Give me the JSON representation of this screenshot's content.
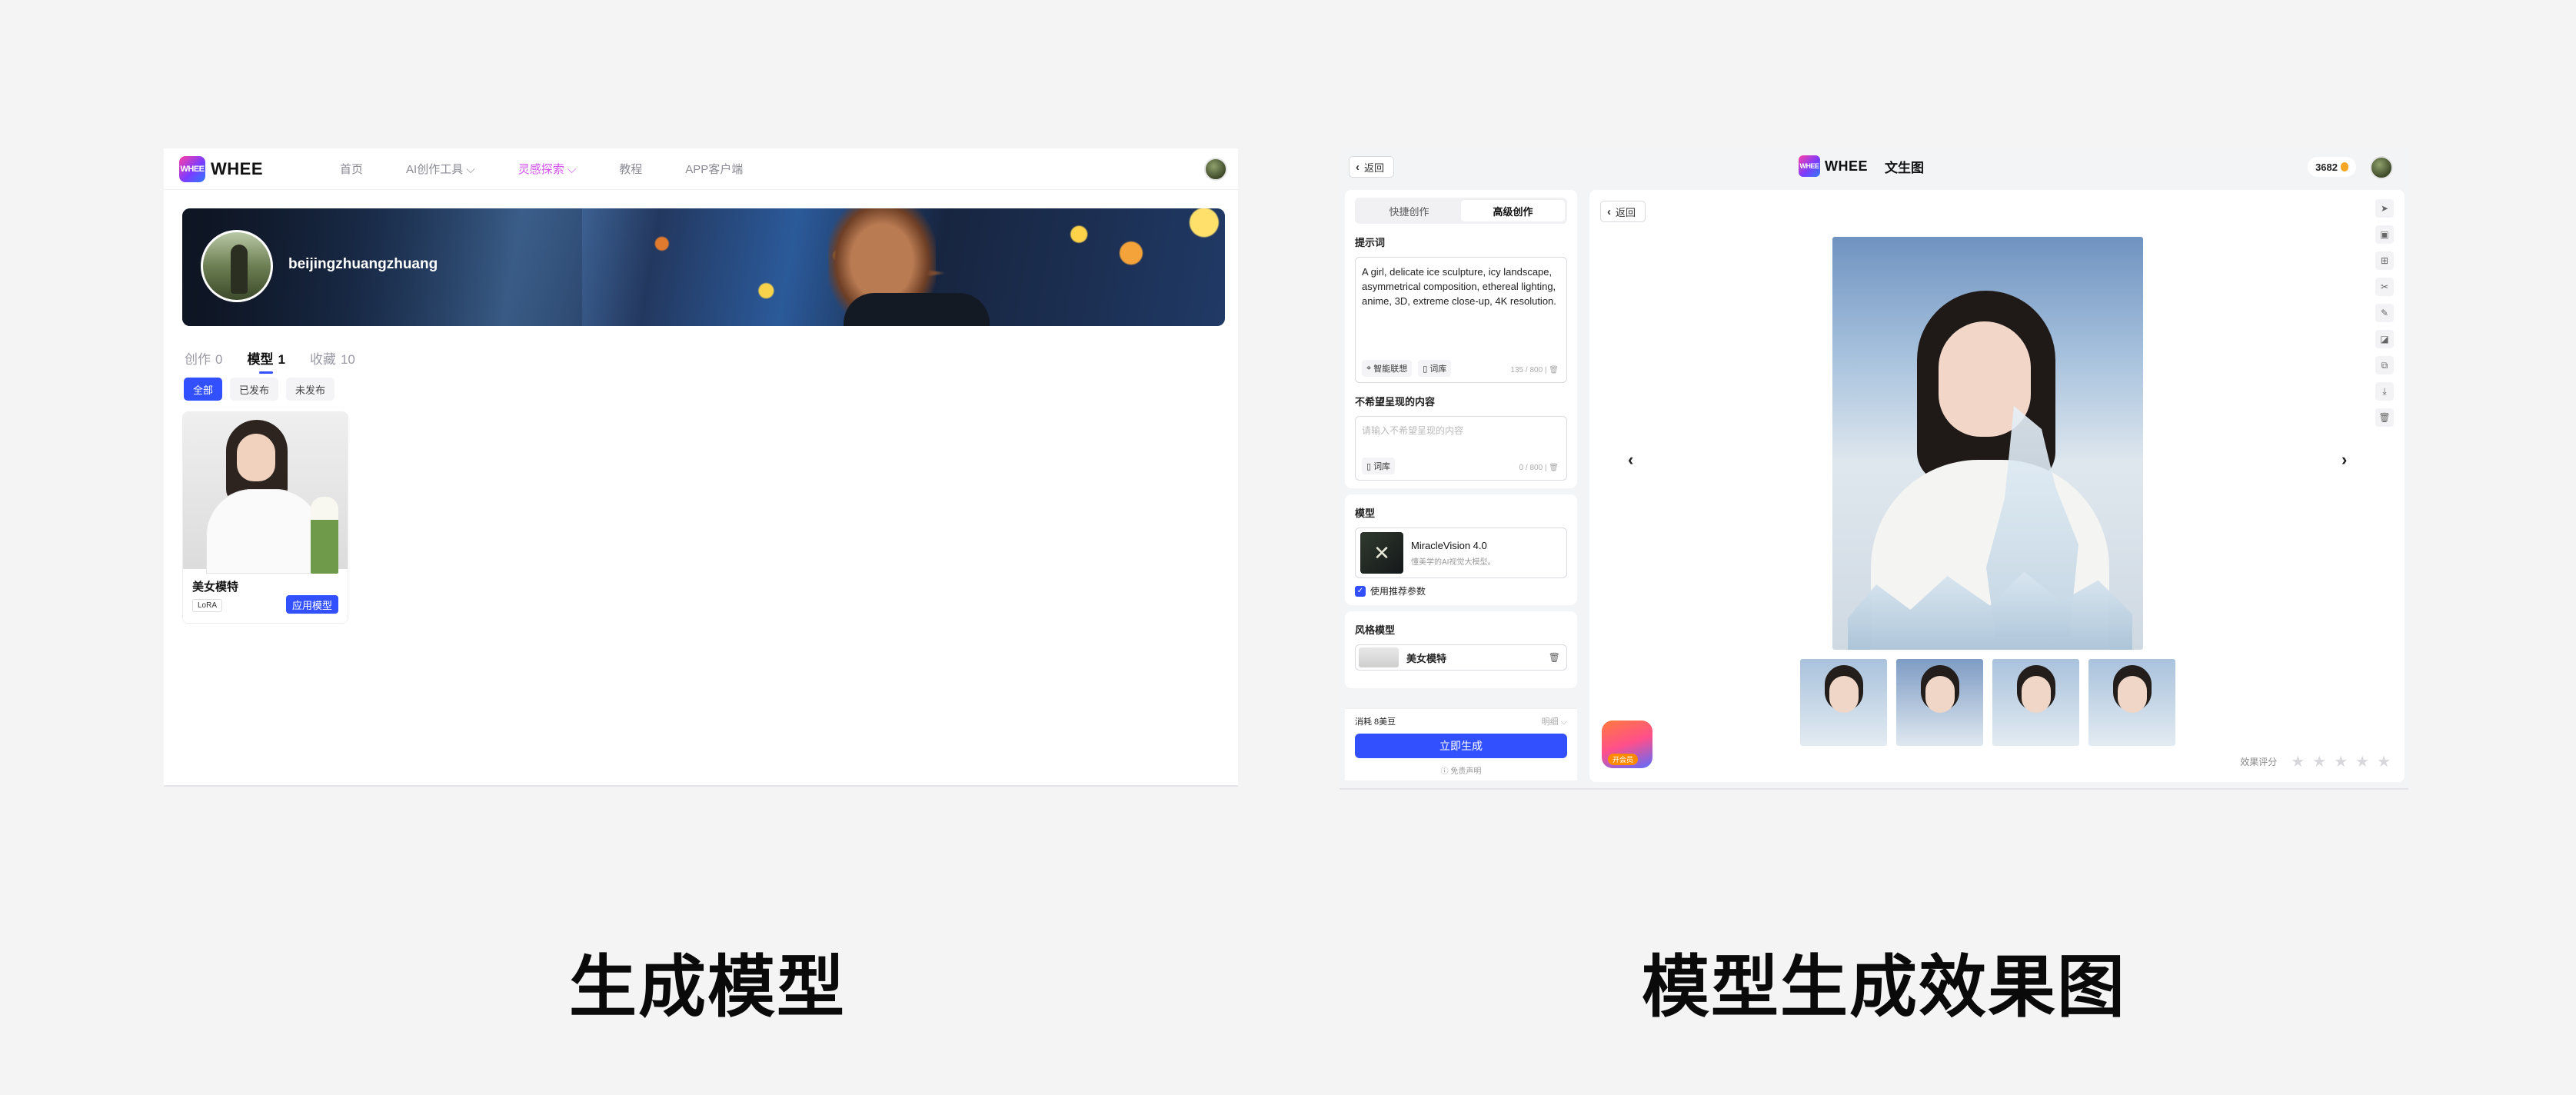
{
  "left": {
    "logo": "WHEE",
    "nav": [
      "首页",
      "AI创作工具 ⌵",
      "灵感探索 ⌵",
      "教程",
      "APP客户端"
    ],
    "username": "beijingzhuangzhuang",
    "tabs": [
      {
        "label": "创作",
        "count": "0"
      },
      {
        "label": "模型",
        "count": "1"
      },
      {
        "label": "收藏",
        "count": "10"
      }
    ],
    "filters": [
      "全部",
      "已发布",
      "未发布"
    ],
    "card": {
      "name": "美女模特",
      "tag": "LoRA",
      "action": "应用模型"
    }
  },
  "right": {
    "back_label": "返回",
    "logo": "WHEE",
    "page_title": "文生图",
    "credits": "3682",
    "modes": [
      "快捷创作",
      "高级创作"
    ],
    "prompt": {
      "label": "提示词",
      "text": "A girl, delicate ice sculpture, icy landscape, asymmetrical composition, ethereal lighting, anime, 3D, extreme close-up, 4K resolution.",
      "tool_smart": "智能联想",
      "tool_lib": "词库",
      "count": "135 / 800"
    },
    "negative": {
      "label": "不希望呈现的内容",
      "placeholder": "请输入不希望呈现的内容",
      "tool_lib": "词库",
      "count": "0 / 800"
    },
    "model": {
      "label": "模型",
      "name": "MiracleVision 4.0",
      "desc": "懂美学的AI视觉大模型。",
      "use_recommended": "使用推荐参数"
    },
    "style": {
      "label": "风格模型",
      "item": "美女模特"
    },
    "cost": "消耗 8美豆",
    "cost_detail": "明细 ⌵",
    "generate": "立即生成",
    "disclaimer": "免责声明",
    "viewer_back": "返回",
    "rating_label": "效果评分",
    "promo_badge": "开会员"
  },
  "captions": {
    "left": "生成模型",
    "right": "模型生成效果图"
  }
}
